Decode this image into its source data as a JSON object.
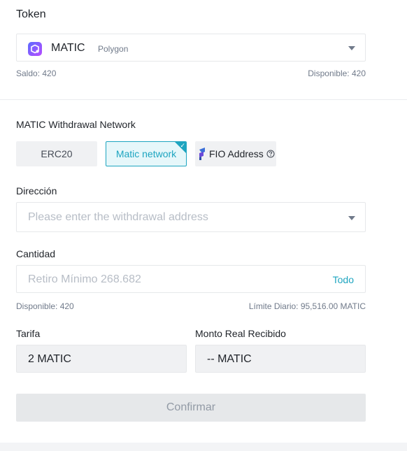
{
  "token_section": {
    "title": "Token",
    "selected_token": "MATIC",
    "selected_network": "Polygon",
    "balance_label": "Saldo: 420",
    "available_label": "Disponible: 420"
  },
  "network_section": {
    "title": "MATIC Withdrawal Network",
    "options": [
      {
        "label": "ERC20",
        "selected": false
      },
      {
        "label": "Matic network",
        "selected": true
      },
      {
        "label": "FIO Address",
        "selected": false
      }
    ]
  },
  "address": {
    "label": "Dirección",
    "placeholder": "Please enter the withdrawal address"
  },
  "amount": {
    "label": "Cantidad",
    "placeholder": "Retiro Mínimo 268.682",
    "all_button": "Todo",
    "available": "Disponible: 420",
    "daily_limit": "Límite Diario: 95,516.00 MATIC"
  },
  "fee": {
    "label": "Tarifa",
    "value": "2 MATIC"
  },
  "received": {
    "label": "Monto Real Recibido",
    "value": "-- MATIC"
  },
  "confirm_button": "Confirmar",
  "colors": {
    "accent": "#1ea5c0",
    "disabled_bg": "#e6e8ea",
    "text_muted": "#707a8a"
  }
}
